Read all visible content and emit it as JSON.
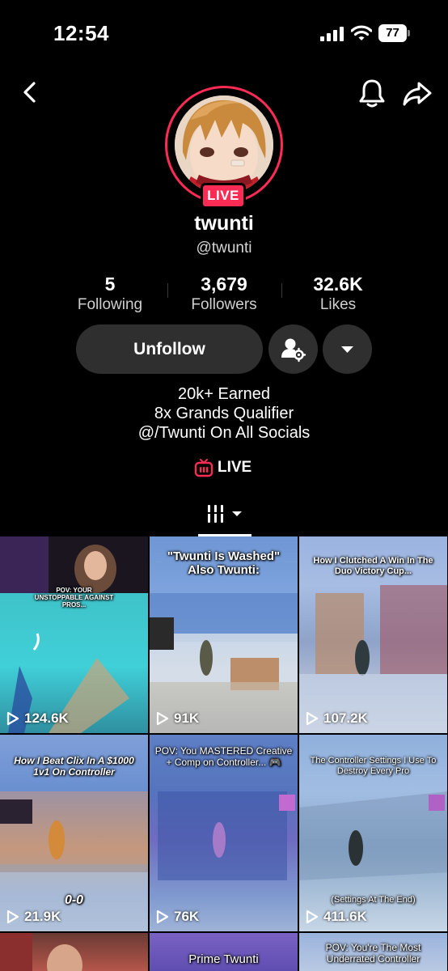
{
  "status_bar": {
    "time": "12:54",
    "battery": "77"
  },
  "profile": {
    "display_name": "twunti",
    "handle": "@twunti",
    "live_badge": "LIVE",
    "stats": [
      {
        "value": "5",
        "label": "Following"
      },
      {
        "value": "3,679",
        "label": "Followers"
      },
      {
        "value": "32.6K",
        "label": "Likes"
      }
    ],
    "unfollow_label": "Unfollow",
    "bio": [
      "20k+ Earned",
      "8x Grands Qualifier",
      "@/Twunti On All Socials"
    ],
    "live_link": "LIVE"
  },
  "videos": [
    {
      "caption": "POV: YOUR UNSTOPPABLE AGAINST PROS...",
      "views": "124.6K"
    },
    {
      "caption": "\"Twunti Is Washed\" Also Twunti:",
      "views": "91K"
    },
    {
      "caption": "How I Clutched A Win In The Duo Victory Cup...",
      "views": "107.2K"
    },
    {
      "caption": "How I Beat Clix In A $1000 1v1 On Controller",
      "overlay": "0-0",
      "views": "21.9K"
    },
    {
      "caption": "POV: You MASTERED Creative + Comp on Controller... 🎮",
      "views": "76K"
    },
    {
      "caption": "The Controller Settings I Use To Destroy Every Pro",
      "overlay": "(Settings At The End)",
      "views": "411.6K"
    },
    {
      "caption": "",
      "views": ""
    },
    {
      "caption": "Prime Twunti",
      "views": ""
    },
    {
      "caption": "POV: You're The Most Underrated Controller",
      "views": ""
    }
  ],
  "colors": {
    "accent": "#fe2c55",
    "button_bg": "#2f2f2f",
    "background": "#000000"
  }
}
